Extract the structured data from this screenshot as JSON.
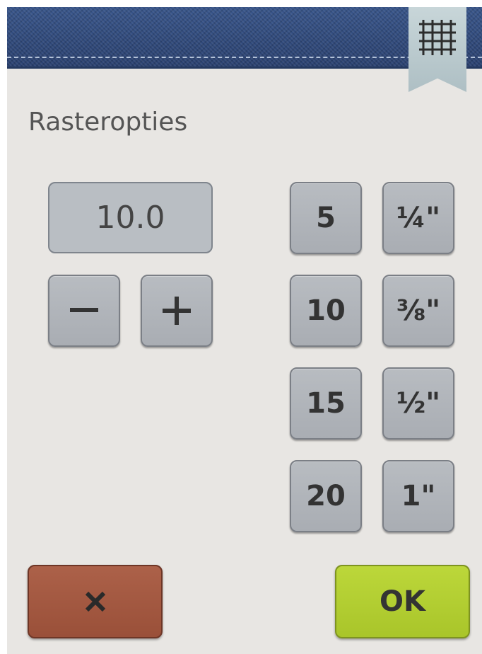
{
  "dialog": {
    "title": "Rasteropties",
    "value": "10.0",
    "header_icon": "grid-icon"
  },
  "stepper": {
    "minus_label": "−",
    "plus_label": "+"
  },
  "presets_metric": [
    "5",
    "10",
    "15",
    "20"
  ],
  "presets_imperial": [
    "¼\"",
    "⅜\"",
    "½\"",
    "1\""
  ],
  "actions": {
    "cancel_icon": "close-icon",
    "ok_label": "OK"
  },
  "colors": {
    "header": "#2f4a7a",
    "panel": "#e8e6e3",
    "button": "#b3b7bc",
    "cancel": "#a65a43",
    "ok": "#b5d132"
  }
}
